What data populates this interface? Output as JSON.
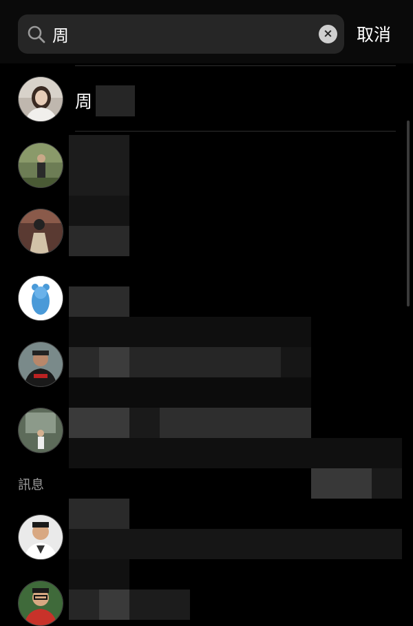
{
  "search": {
    "query": "周",
    "clear_glyph": "×",
    "cancel_label": "取消"
  },
  "results": {
    "top": {
      "name": "周"
    }
  },
  "sections": {
    "messages_label": "訊息"
  },
  "icons": {
    "search": "search-icon",
    "clear": "clear-icon"
  },
  "colors": {
    "background": "#000000",
    "search_bg": "#262626",
    "muted": "#9a9a9a"
  }
}
